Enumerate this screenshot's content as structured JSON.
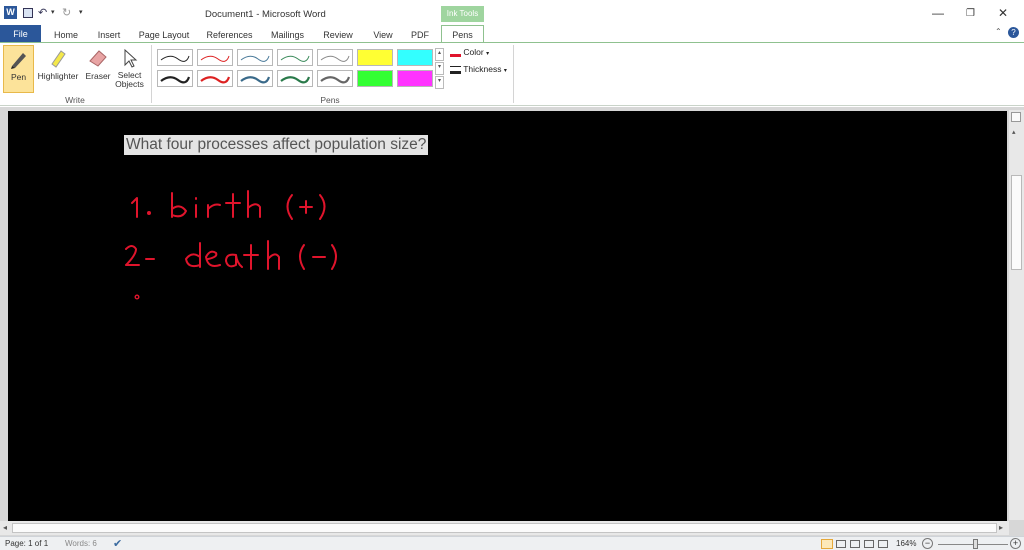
{
  "window": {
    "title": "Document1 - Microsoft Word"
  },
  "contextual_tab_group": "Ink Tools",
  "tabs": [
    "File",
    "Home",
    "Insert",
    "Page Layout",
    "References",
    "Mailings",
    "Review",
    "View",
    "PDF",
    "Pens"
  ],
  "ribbon": {
    "write": {
      "pen": "Pen",
      "highlighter": "Highlighter",
      "eraser": "Eraser",
      "select_objects_1": "Select",
      "select_objects_2": "Objects",
      "group_label": "Write"
    },
    "pens": {
      "group_label": "Pens",
      "color": "Color",
      "thickness": "Thickness"
    }
  },
  "document": {
    "question": "What four processes affect population size?",
    "ink_line1": "1. birth (+)",
    "ink_line2": "2- death (-)"
  },
  "status": {
    "page": "Page: 1 of 1",
    "words": "Words: 6",
    "zoom": "164%"
  },
  "colors": {
    "accent_file": "#2b579a",
    "ink": "#e0142c",
    "contextual": "#7bc47b"
  }
}
